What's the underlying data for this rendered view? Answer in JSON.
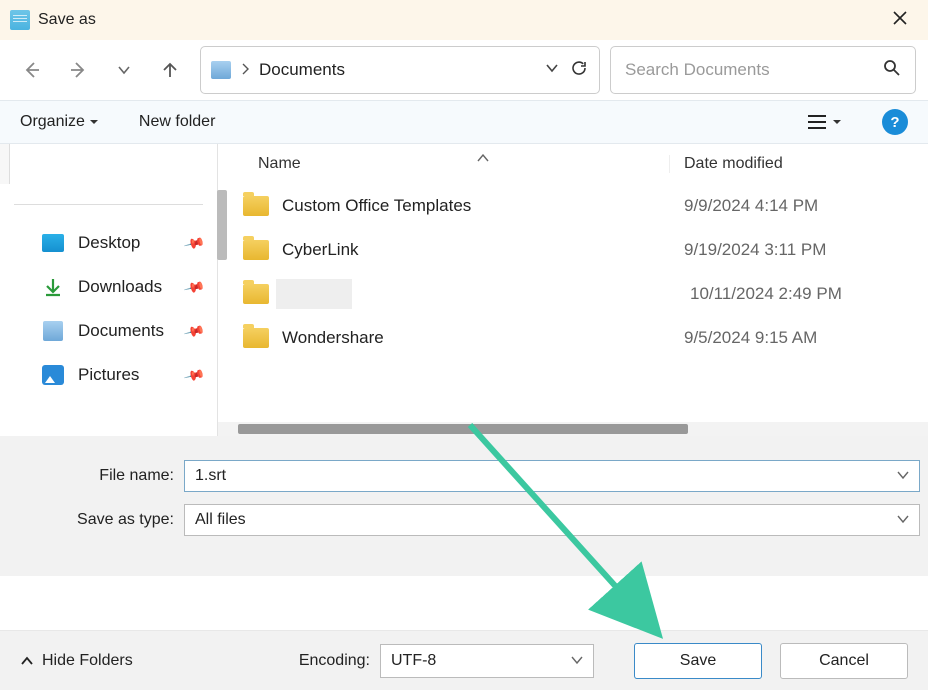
{
  "title": "Save as",
  "nav": {
    "location": "Documents",
    "search_placeholder": "Search Documents"
  },
  "toolbar": {
    "organize": "Organize",
    "new_folder": "New folder"
  },
  "columns": {
    "name": "Name",
    "date": "Date modified"
  },
  "sidebar": {
    "items": [
      {
        "label": "Desktop"
      },
      {
        "label": "Downloads"
      },
      {
        "label": "Documents"
      },
      {
        "label": "Pictures"
      }
    ]
  },
  "files": [
    {
      "name": "Custom Office Templates",
      "date": "9/9/2024 4:14 PM"
    },
    {
      "name": "CyberLink",
      "date": "9/19/2024 3:11 PM"
    },
    {
      "name": "",
      "date": "10/11/2024 2:49 PM"
    },
    {
      "name": "Wondershare",
      "date": "9/5/2024 9:15 AM"
    }
  ],
  "form": {
    "filename_label": "File name:",
    "filename_value": "1.srt",
    "type_label": "Save as type:",
    "type_value": "All files"
  },
  "footer": {
    "hide_folders": "Hide Folders",
    "encoding_label": "Encoding:",
    "encoding_value": "UTF-8",
    "save": "Save",
    "cancel": "Cancel"
  }
}
